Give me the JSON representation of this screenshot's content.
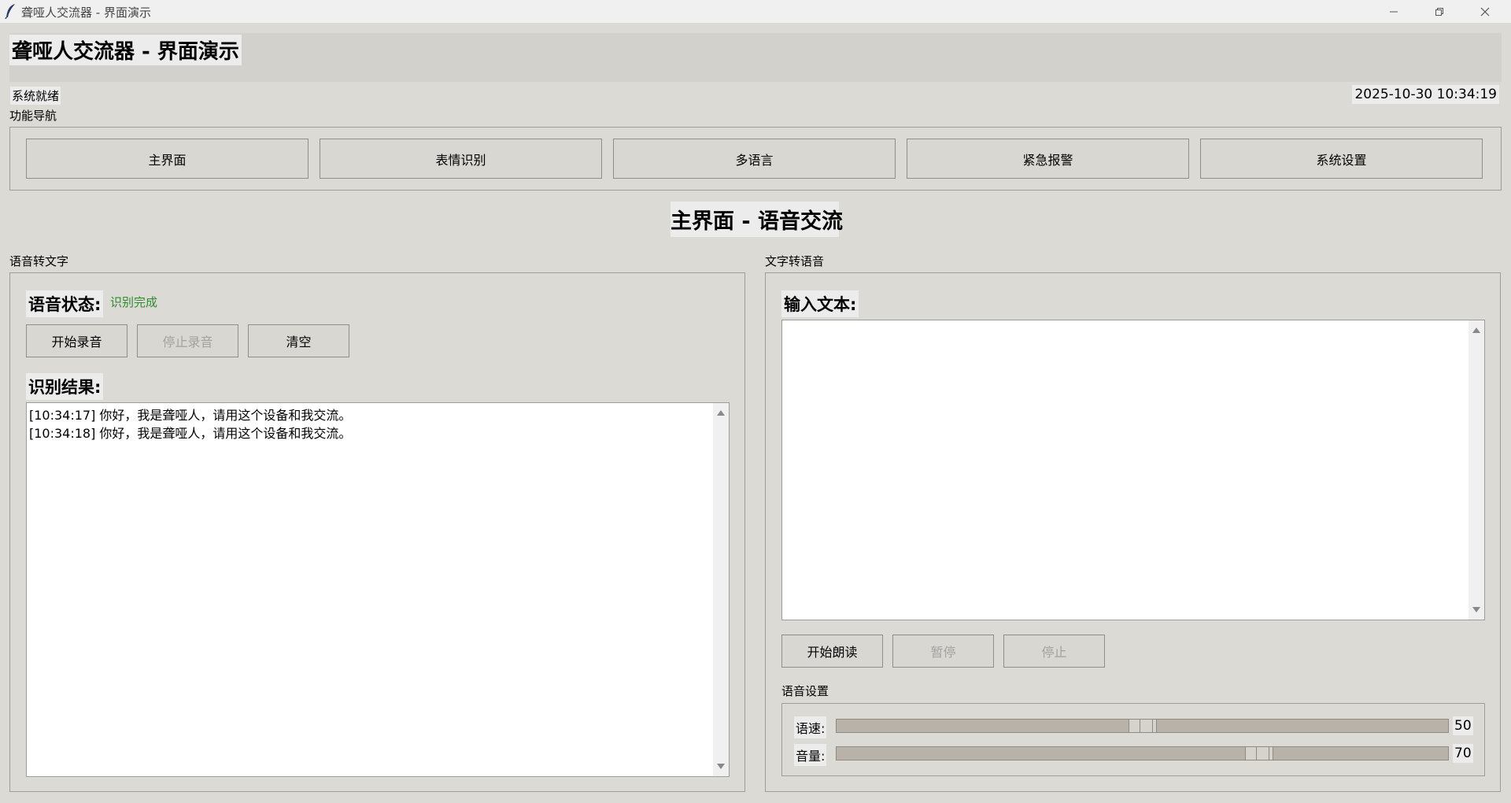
{
  "window": {
    "title": "聋哑人交流器 - 界面演示",
    "icons": [
      "feather-icon",
      "minimize-icon",
      "restore-icon",
      "close-icon"
    ]
  },
  "header": {
    "title": "聋哑人交流器 - 界面演示",
    "status": "系统就绪",
    "datetime": "2025-10-30 10:34:19"
  },
  "nav": {
    "label": "功能导航",
    "buttons": [
      "主界面",
      "表情识别",
      "多语言",
      "紧急报警",
      "系统设置"
    ]
  },
  "page": {
    "heading": "主界面 - 语音交流"
  },
  "speech_to_text": {
    "label": "语音转文字",
    "status_label": "语音状态:",
    "status_value": "识别完成",
    "status_color": "#2e8b2e",
    "buttons": {
      "start": "开始录音",
      "stop": "停止录音",
      "clear": "清空"
    },
    "result_label": "识别结果:",
    "results": [
      "[10:34:17] 你好，我是聋哑人，请用这个设备和我交流。",
      "[10:34:18] 你好，我是聋哑人，请用这个设备和我交流。"
    ]
  },
  "text_to_speech": {
    "label": "文字转语音",
    "input_label": "输入文本:",
    "input_value": "",
    "buttons": {
      "start": "开始朗读",
      "pause": "暂停",
      "stop": "停止"
    },
    "settings": {
      "label": "语音设置",
      "speed_label": "语速:",
      "speed_value": "50",
      "volume_label": "音量:",
      "volume_value": "70"
    }
  },
  "colors": {
    "background": "#dcdad5",
    "disabled_text": "#a3a29e",
    "label_bg": "#ececec"
  }
}
